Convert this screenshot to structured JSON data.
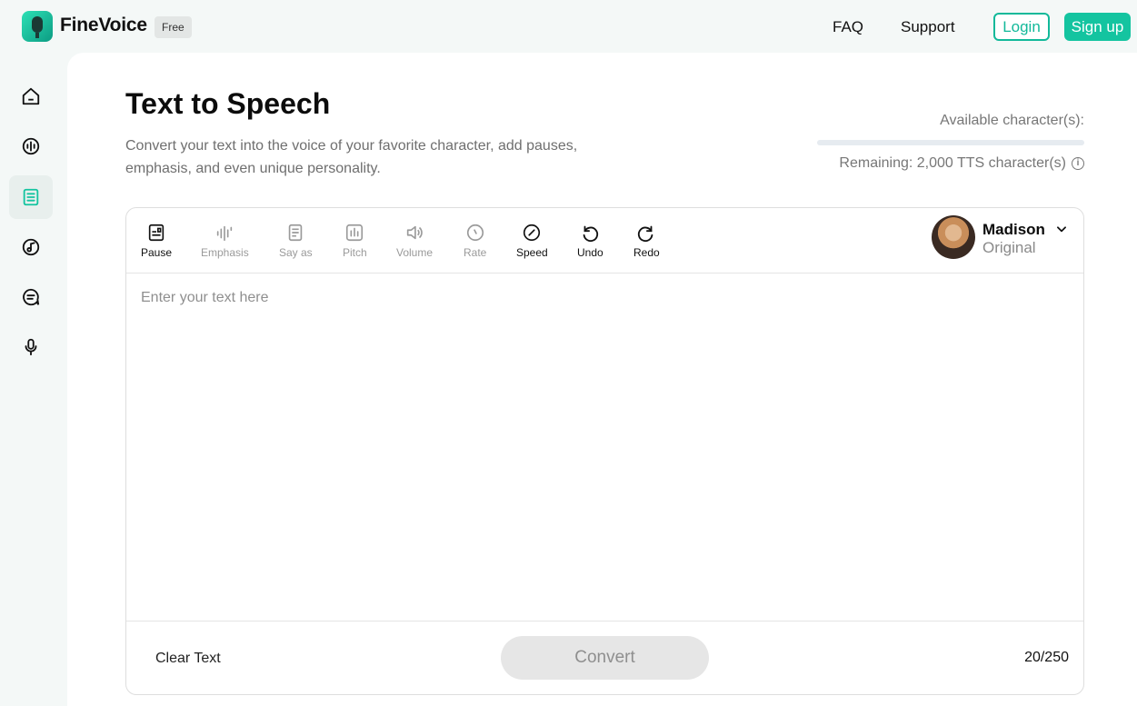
{
  "header": {
    "brand": "FineVoice",
    "badge": "Free",
    "nav": {
      "faq": "FAQ",
      "support": "Support"
    },
    "login": "Login",
    "signup": "Sign up"
  },
  "sidebar": {
    "items": [
      {
        "icon": "home-icon",
        "active": false
      },
      {
        "icon": "voice-changer-icon",
        "active": false
      },
      {
        "icon": "text-to-speech-icon",
        "active": true
      },
      {
        "icon": "music-icon",
        "active": false
      },
      {
        "icon": "chat-icon",
        "active": false
      },
      {
        "icon": "microphone-icon",
        "active": false
      }
    ]
  },
  "main": {
    "title": "Text to Speech",
    "subtitle": "Convert your text into the voice of your favorite character, add pauses, emphasis, and even unique personality.",
    "available_label": "Available character(s):",
    "quota_fraction": 0.0,
    "remaining": "Remaining: 2,000 TTS character(s)"
  },
  "toolbar": {
    "pause": "Pause",
    "emphasis": "Emphasis",
    "say_as": "Say as",
    "pitch": "Pitch",
    "volume": "Volume",
    "rate": "Rate",
    "speed": "Speed",
    "undo": "Undo",
    "redo": "Redo"
  },
  "voice": {
    "name": "Madison",
    "style": "Original"
  },
  "editor": {
    "placeholder": "Enter your text here",
    "value": ""
  },
  "footer": {
    "clear": "Clear Text",
    "convert": "Convert",
    "count": "20/250"
  },
  "colors": {
    "accent": "#14c4a0",
    "disabled": "#9a9a9a"
  }
}
